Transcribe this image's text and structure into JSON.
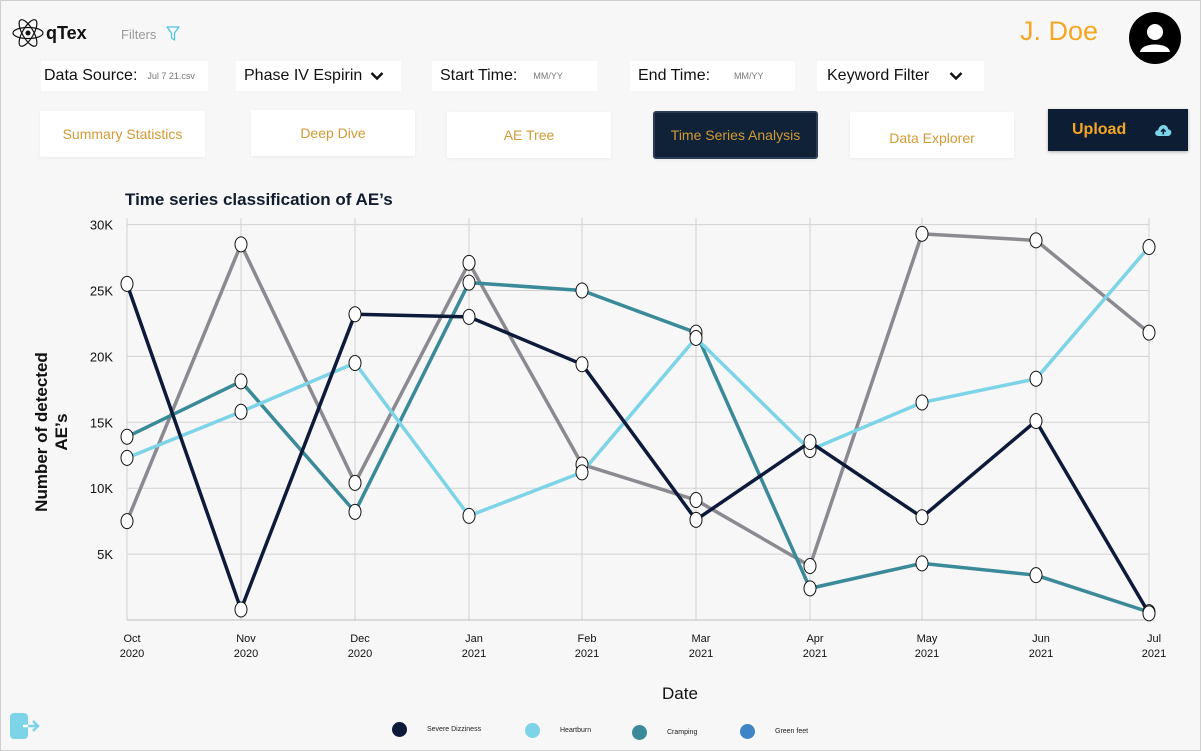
{
  "app": {
    "name": "qTex"
  },
  "header": {
    "filters_label": "Filters",
    "user_name": "J. Doe"
  },
  "controls": {
    "data_source_label": "Data Source:",
    "data_source_value": "Jul 7 21.csv",
    "study_value": "Phase IV Espirin",
    "start_time_label": "Start Time:",
    "start_time_placeholder": "MM/YY",
    "end_time_label": "End Time:",
    "end_time_placeholder": "MM/YY",
    "keyword_filter_label": "Keyword Filter"
  },
  "tabs": [
    {
      "label": "Summary Statistics",
      "active": false
    },
    {
      "label": "Deep Dive",
      "active": false
    },
    {
      "label": "AE Tree",
      "active": false
    },
    {
      "label": "Time Series Analysis",
      "active": true
    },
    {
      "label": "Data Explorer",
      "active": false
    }
  ],
  "upload": {
    "label": "Upload",
    "icon": "cloud-upload-icon"
  },
  "colors": {
    "accent": "#f5a623",
    "navy": "#0f2238"
  },
  "chart_data": {
    "type": "line",
    "title": "Time series classification of AE’s",
    "xlabel": "Date",
    "ylabel": "Number of detected AE’s",
    "x_ticks": [
      {
        "month": "Oct",
        "year": "2020"
      },
      {
        "month": "Nov",
        "year": "2020"
      },
      {
        "month": "Dec",
        "year": "2020"
      },
      {
        "month": "Jan",
        "year": "2021"
      },
      {
        "month": "Feb",
        "year": "2021"
      },
      {
        "month": "Mar",
        "year": "2021"
      },
      {
        "month": "Apr",
        "year": "2021"
      },
      {
        "month": "May",
        "year": "2021"
      },
      {
        "month": "Jun",
        "year": "2021"
      },
      {
        "month": "Jul",
        "year": "2021"
      }
    ],
    "y_ticks": [
      "30K",
      "25K",
      "20K",
      "15K",
      "10K",
      "5K"
    ],
    "y_tick_values": [
      30000,
      25000,
      20000,
      15000,
      10000,
      5000
    ],
    "ylim": [
      0,
      30500
    ],
    "grid": true,
    "legend_position": "bottom",
    "series": [
      {
        "name": "Severe Dizziness",
        "color": "#0d1a3a",
        "values": [
          25500,
          800,
          23200,
          23000,
          19400,
          7600,
          13500,
          7800,
          15100,
          500
        ]
      },
      {
        "name": "Heartburn",
        "color": "#7dd4e8",
        "values": [
          12300,
          15800,
          19500,
          7900,
          11200,
          21400,
          12900,
          16500,
          18300,
          28300
        ]
      },
      {
        "name": "Cramping",
        "color": "#3a8a9a",
        "values": [
          13900,
          18100,
          8200,
          25600,
          25000,
          21800,
          2400,
          4300,
          3400,
          600
        ]
      },
      {
        "name": "Green feet",
        "color": "#3d85c6",
        "values": []
      },
      {
        "name": "",
        "color": "#8a8a90",
        "values": [
          7500,
          28500,
          10400,
          27100,
          11800,
          9100,
          4100,
          29300,
          28800,
          21800
        ]
      }
    ]
  }
}
